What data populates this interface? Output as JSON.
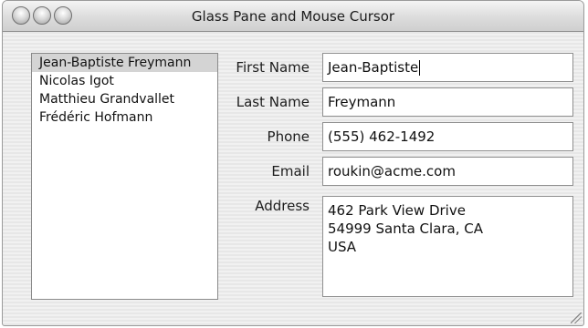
{
  "window": {
    "title": "Glass Pane and Mouse Cursor"
  },
  "list": {
    "items": [
      {
        "label": "Jean-Baptiste Freymann",
        "selected": true
      },
      {
        "label": "Nicolas Igot",
        "selected": false
      },
      {
        "label": "Matthieu Grandvallet",
        "selected": false
      },
      {
        "label": "Frédéric Hofmann",
        "selected": false
      }
    ]
  },
  "form": {
    "first_name": {
      "label": "First Name",
      "value": "Jean-Baptiste"
    },
    "last_name": {
      "label": "Last Name",
      "value": "Freymann"
    },
    "phone": {
      "label": "Phone",
      "value": "(555) 462-1492"
    },
    "email": {
      "label": "Email",
      "value": "roukin@acme.com"
    },
    "address": {
      "label": "Address",
      "lines": [
        "462 Park View Drive",
        "54999 Santa Clara, CA",
        "USA"
      ]
    }
  },
  "colors": {
    "selection": "#d4d4d4",
    "window_bg": "#ececec"
  }
}
